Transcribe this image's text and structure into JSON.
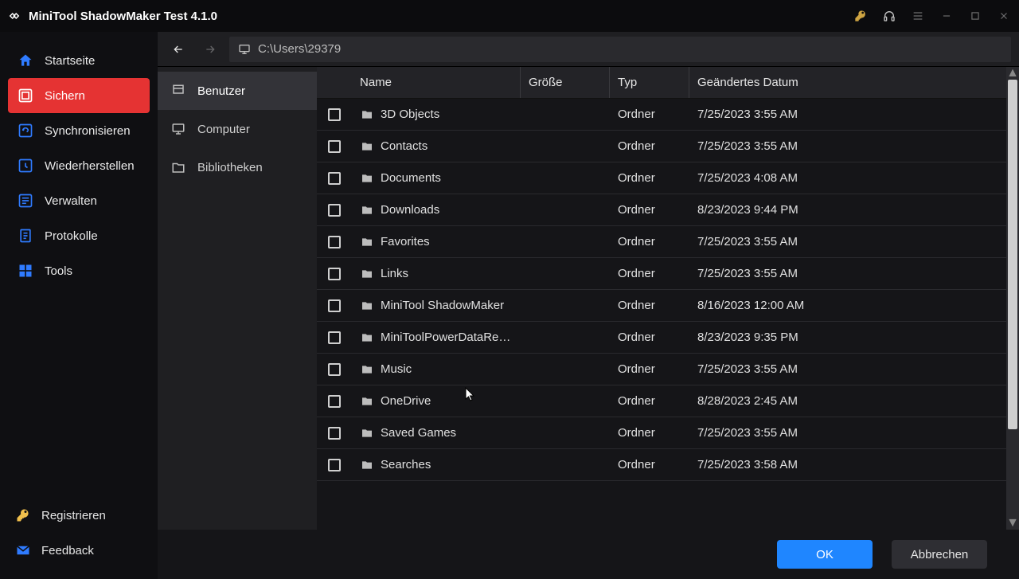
{
  "titlebar": {
    "title": "MiniTool ShadowMaker Test 4.1.0"
  },
  "sidebar": {
    "items": [
      {
        "label": "Startseite",
        "icon": "home"
      },
      {
        "label": "Sichern",
        "icon": "backup",
        "active": true
      },
      {
        "label": "Synchronisieren",
        "icon": "sync"
      },
      {
        "label": "Wiederherstellen",
        "icon": "restore"
      },
      {
        "label": "Verwalten",
        "icon": "manage"
      },
      {
        "label": "Protokolle",
        "icon": "logs"
      },
      {
        "label": "Tools",
        "icon": "tools"
      }
    ],
    "register": "Registrieren",
    "feedback": "Feedback"
  },
  "toolbar": {
    "path": "C:\\Users\\29379"
  },
  "tree": {
    "items": [
      {
        "label": "Benutzer",
        "active": true
      },
      {
        "label": "Computer"
      },
      {
        "label": "Bibliotheken"
      }
    ]
  },
  "table": {
    "headers": {
      "name": "Name",
      "size": "Größe",
      "type": "Typ",
      "date": "Geändertes Datum"
    },
    "rows": [
      {
        "name": "3D Objects",
        "size": "",
        "type": "Ordner",
        "date": "7/25/2023 3:55 AM"
      },
      {
        "name": "Contacts",
        "size": "",
        "type": "Ordner",
        "date": "7/25/2023 3:55 AM"
      },
      {
        "name": "Documents",
        "size": "",
        "type": "Ordner",
        "date": "7/25/2023 4:08 AM"
      },
      {
        "name": "Downloads",
        "size": "",
        "type": "Ordner",
        "date": "8/23/2023 9:44 PM"
      },
      {
        "name": "Favorites",
        "size": "",
        "type": "Ordner",
        "date": "7/25/2023 3:55 AM"
      },
      {
        "name": "Links",
        "size": "",
        "type": "Ordner",
        "date": "7/25/2023 3:55 AM"
      },
      {
        "name": "MiniTool ShadowMaker",
        "size": "",
        "type": "Ordner",
        "date": "8/16/2023 12:00 AM"
      },
      {
        "name": "MiniToolPowerDataRecov…",
        "size": "",
        "type": "Ordner",
        "date": "8/23/2023 9:35 PM"
      },
      {
        "name": "Music",
        "size": "",
        "type": "Ordner",
        "date": "7/25/2023 3:55 AM"
      },
      {
        "name": "OneDrive",
        "size": "",
        "type": "Ordner",
        "date": "8/28/2023 2:45 AM"
      },
      {
        "name": "Saved Games",
        "size": "",
        "type": "Ordner",
        "date": "7/25/2023 3:55 AM"
      },
      {
        "name": "Searches",
        "size": "",
        "type": "Ordner",
        "date": "7/25/2023 3:58 AM"
      }
    ]
  },
  "footer": {
    "ok": "OK",
    "cancel": "Abbrechen"
  }
}
